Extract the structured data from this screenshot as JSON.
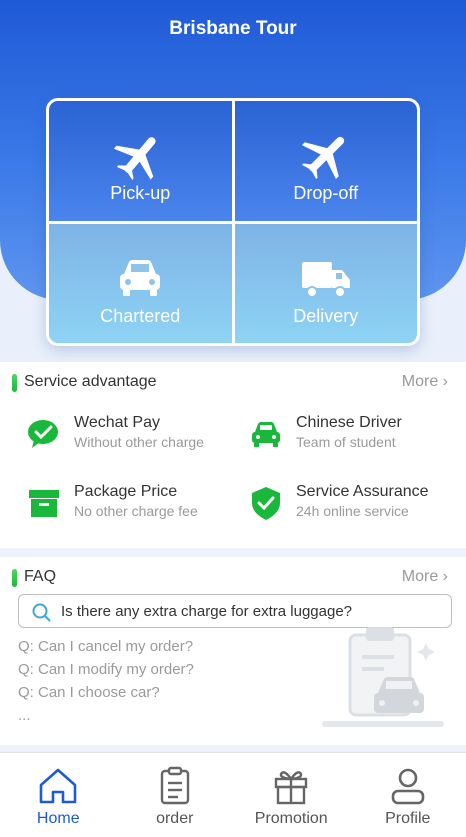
{
  "header": {
    "title": "Brisbane Tour"
  },
  "services": [
    {
      "label": "Pick-up",
      "icon": "plane-landing-icon"
    },
    {
      "label": "Drop-off",
      "icon": "plane-takeoff-icon"
    },
    {
      "label": "Chartered",
      "icon": "car-icon"
    },
    {
      "label": "Delivery",
      "icon": "truck-icon"
    }
  ],
  "advantage": {
    "title": "Service advantage",
    "more": "More",
    "items": [
      {
        "title": "Wechat Pay",
        "subtitle": "Without other charge",
        "icon": "wechat-icon"
      },
      {
        "title": "Chinese Driver",
        "subtitle": "Team of student",
        "icon": "car-icon"
      },
      {
        "title": "Package Price",
        "subtitle": "No other charge fee",
        "icon": "box-icon"
      },
      {
        "title": "Service Assurance",
        "subtitle": "24h online service",
        "icon": "shield-check-icon"
      }
    ]
  },
  "faq": {
    "title": "FAQ",
    "more": "More",
    "search_text": "Is there any extra charge for extra luggage?",
    "questions": [
      "Q: Can I cancel my order?",
      "Q: Can I modify my order?",
      "Q: Can I choose car?",
      "..."
    ]
  },
  "tabs": [
    {
      "label": "Home",
      "icon": "home-icon",
      "active": true
    },
    {
      "label": "order",
      "icon": "clipboard-icon",
      "active": false
    },
    {
      "label": "Promotion",
      "icon": "gift-icon",
      "active": false
    },
    {
      "label": "Profile",
      "icon": "user-icon",
      "active": false
    }
  ],
  "colors": {
    "primary": "#1f5ad6",
    "accent_green": "#19b83a",
    "muted": "#9a9a9a"
  }
}
